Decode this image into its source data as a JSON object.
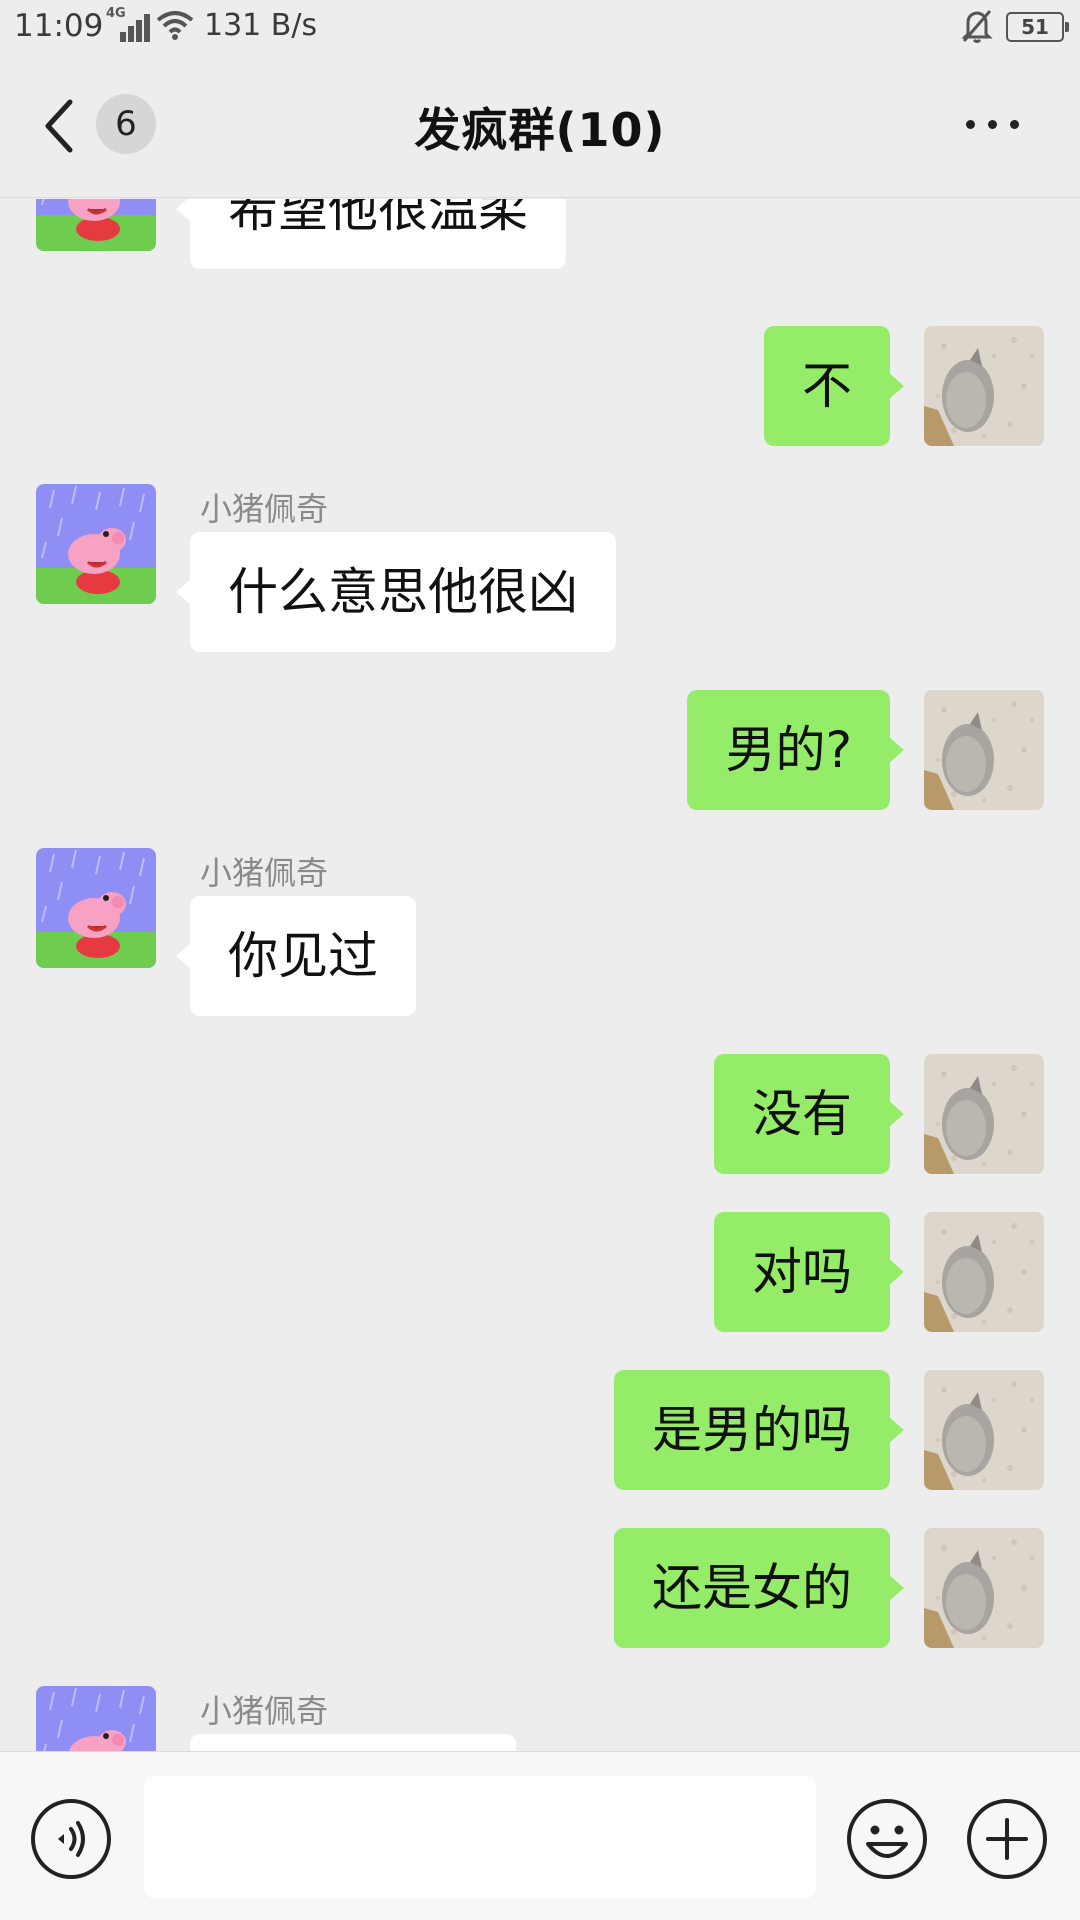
{
  "status_bar": {
    "time": "11:09",
    "network": "4G",
    "speed": "131 B/s",
    "battery": "51"
  },
  "header": {
    "unread_count": "6",
    "title": "发疯群(10)"
  },
  "messages": [
    {
      "side": "in",
      "sender": "",
      "text": "希望他很温柔",
      "avatar": "peppa-pig-avatar"
    },
    {
      "side": "out",
      "text": "不",
      "avatar": "cat-avatar"
    },
    {
      "side": "in",
      "sender": "小猪佩奇",
      "text": "什么意思他很凶",
      "avatar": "peppa-pig-avatar"
    },
    {
      "side": "out",
      "text": "男的?",
      "avatar": "cat-avatar"
    },
    {
      "side": "in",
      "sender": "小猪佩奇",
      "text": "你见过",
      "avatar": "peppa-pig-avatar"
    },
    {
      "side": "out",
      "text": "没有",
      "avatar": "cat-avatar"
    },
    {
      "side": "out",
      "text": "对吗",
      "avatar": "cat-avatar"
    },
    {
      "side": "out",
      "text": "是男的吗",
      "avatar": "cat-avatar"
    },
    {
      "side": "out",
      "text": "还是女的",
      "avatar": "cat-avatar"
    },
    {
      "side": "in",
      "sender": "小猪佩奇",
      "text": "",
      "avatar": "peppa-pig-avatar"
    }
  ],
  "input": {
    "value": "",
    "placeholder": ""
  },
  "colors": {
    "background": "#ededed",
    "outgoing_bubble": "#95ec69",
    "incoming_bubble": "#ffffff"
  }
}
